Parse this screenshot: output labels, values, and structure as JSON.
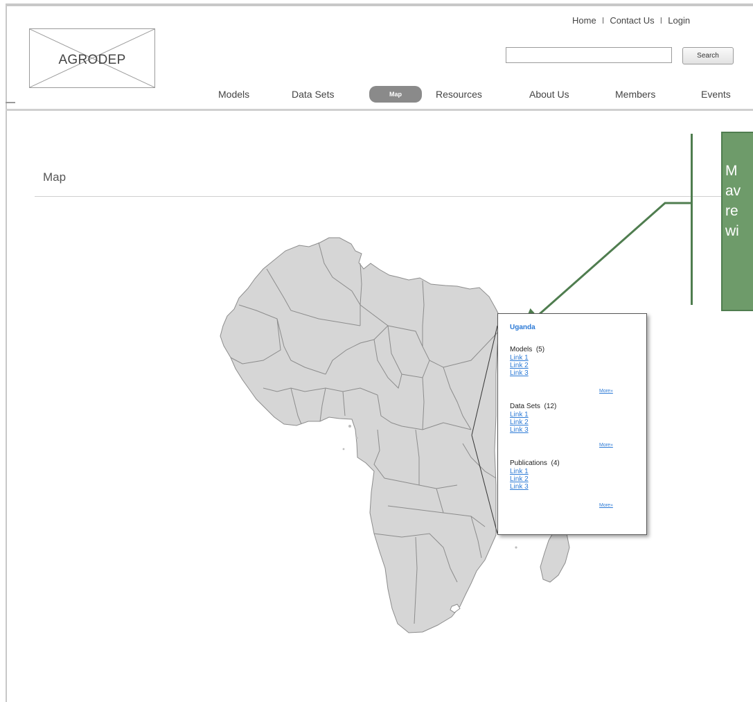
{
  "header": {
    "logo_text": "AGRODEP",
    "top_links": [
      "Home",
      "Contact Us",
      "Login"
    ],
    "separator": "I",
    "search": {
      "value": "",
      "placeholder": "",
      "button_label": "Search"
    }
  },
  "nav": {
    "items": [
      "Models",
      "Data Sets",
      "Map",
      "Resources",
      "About Us",
      "Members",
      "Events"
    ],
    "active": "Map"
  },
  "page": {
    "title": "Map"
  },
  "annotation": {
    "lines": [
      "M",
      "av",
      "re",
      "wi"
    ]
  },
  "popup": {
    "country": "Uganda",
    "sections": [
      {
        "title": "Models",
        "count": "(5)",
        "links": [
          "Link 1",
          "Link 2",
          "Link 3"
        ],
        "more": "More»"
      },
      {
        "title": "Data Sets",
        "count": "(12)",
        "links": [
          "Link 1",
          "Link 2",
          "Link 3"
        ],
        "more": "More»"
      },
      {
        "title": "Publications",
        "count": "(4)",
        "links": [
          "Link 1",
          "Link 2",
          "Link 3"
        ],
        "more": "More»"
      }
    ]
  },
  "colors": {
    "nav_active_bg": "#8a8a8a",
    "map_fill": "#d6d6d6",
    "map_border": "#8c8c8c",
    "annotation_bg": "#6e9b6a",
    "annotation_border": "#4f7d4f",
    "link": "#2c7ad6"
  },
  "icons": {
    "logo_placeholder": "x-box-icon"
  }
}
